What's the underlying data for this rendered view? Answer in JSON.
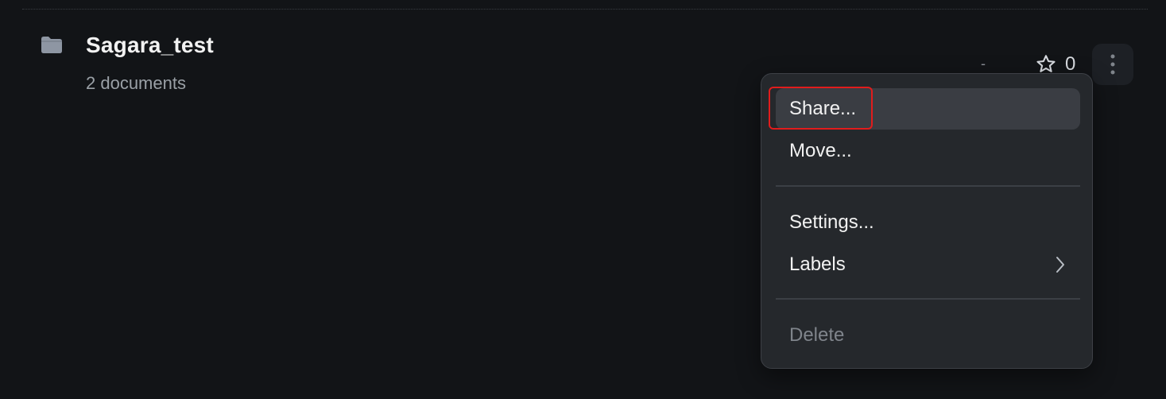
{
  "collection": {
    "title": "Sagara_test",
    "subtitle": "2 documents",
    "updated": "-",
    "star_count": "0",
    "folder_icon": "folder-icon",
    "star_icon": "star-outline-icon",
    "more_icon": "vertical-ellipsis-icon"
  },
  "menu": {
    "items": [
      {
        "label": "Share...",
        "state": "hover"
      },
      {
        "label": "Move..."
      },
      {
        "label": "Settings..."
      },
      {
        "label": "Labels",
        "submenu_icon": "chevron-right-icon"
      },
      {
        "label": "Delete",
        "state": "disabled"
      }
    ]
  },
  "colors": {
    "background": "#121417",
    "menu_background": "#25282c",
    "menu_hover": "#3a3d43",
    "highlight": "#e11c1c",
    "muted_text": "#9aa0a6"
  }
}
